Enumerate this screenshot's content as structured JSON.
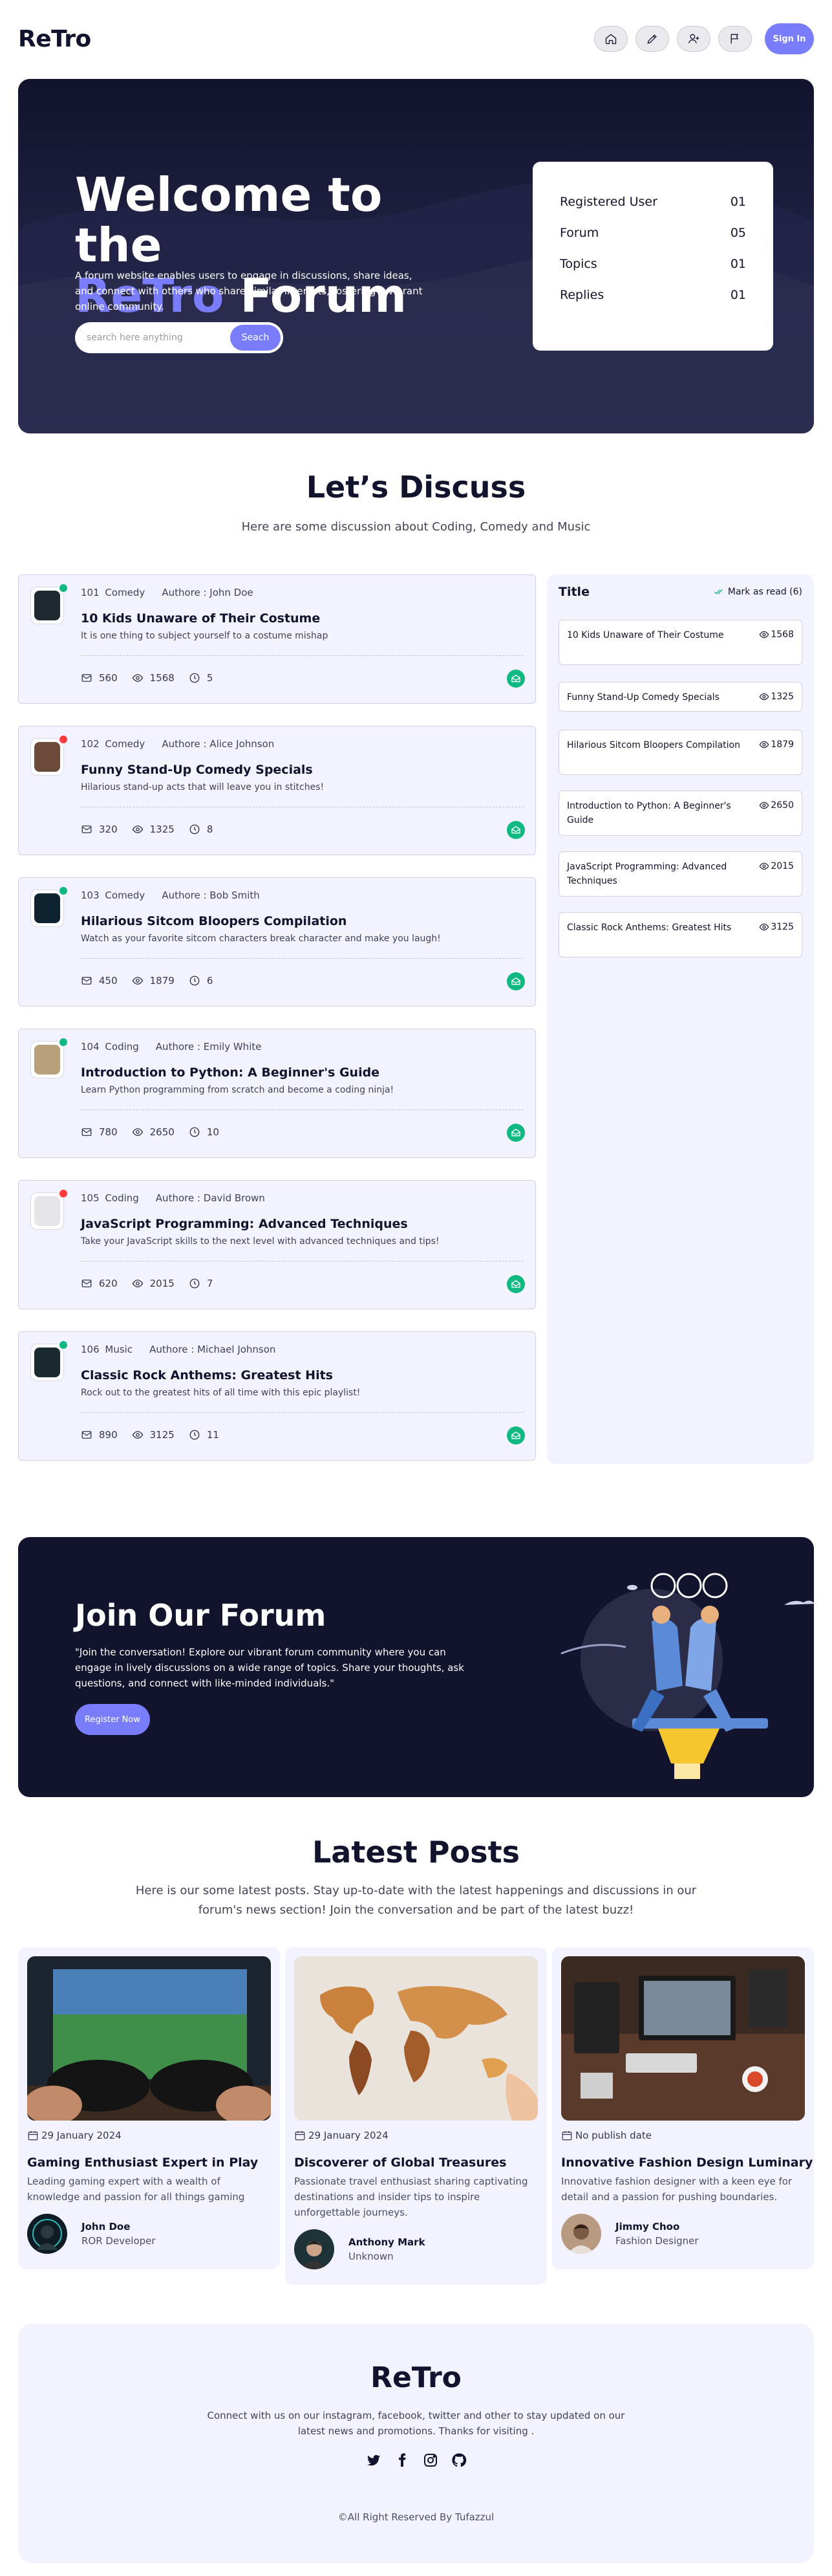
{
  "nav": {
    "logo": "ReTro",
    "icons": [
      "home-icon",
      "pencil-icon",
      "add-user-icon",
      "flag-icon"
    ],
    "signin": "Sign In"
  },
  "hero": {
    "title_line1": "Welcome to the",
    "title_accent": "ReTro",
    "title_rest": " Forum",
    "description": "A forum website enables users to engage in discussions, share ideas, and connect with others who share similar interests, fostering a vibrant online community.",
    "search_placeholder": "search here anything",
    "search_button": "Seach",
    "stats": [
      {
        "label": "Registered User",
        "value": "01"
      },
      {
        "label": "Forum",
        "value": "05"
      },
      {
        "label": "Topics",
        "value": "01"
      },
      {
        "label": "Replies",
        "value": "01"
      }
    ]
  },
  "discuss": {
    "title": "Let’s Discuss",
    "subtitle": "Here are some discussion about Coding, Comedy and Music",
    "posts": [
      {
        "id": "101",
        "category": "Comedy",
        "author": "Authore : John Doe",
        "title": "10 Kids Unaware of Their Costume",
        "desc": "It is one thing to subject yourself to a costume mishap",
        "comments": "560",
        "views": "1568",
        "time": "5",
        "status_color": "#10b981"
      },
      {
        "id": "102",
        "category": "Comedy",
        "author": "Authore : Alice Johnson",
        "title": "Funny Stand-Up Comedy Specials",
        "desc": "Hilarious stand-up acts that will leave you in stitches!",
        "comments": "320",
        "views": "1325",
        "time": "8",
        "status_color": "#ff3b3b"
      },
      {
        "id": "103",
        "category": "Comedy",
        "author": "Authore : Bob Smith",
        "title": "Hilarious Sitcom Bloopers Compilation",
        "desc": "Watch as your favorite sitcom characters break character and make you laugh!",
        "comments": "450",
        "views": "1879",
        "time": "6",
        "status_color": "#10b981"
      },
      {
        "id": "104",
        "category": "Coding",
        "author": "Authore : Emily White",
        "title": "Introduction to Python: A Beginner's Guide",
        "desc": "Learn Python programming from scratch and become a coding ninja!",
        "comments": "780",
        "views": "2650",
        "time": "10",
        "status_color": "#10b981"
      },
      {
        "id": "105",
        "category": "Coding",
        "author": "Authore : David Brown",
        "title": "JavaScript Programming: Advanced Techniques",
        "desc": "Take your JavaScript skills to the next level with advanced techniques and tips!",
        "comments": "620",
        "views": "2015",
        "time": "7",
        "status_color": "#ff3b3b"
      },
      {
        "id": "106",
        "category": "Music",
        "author": "Authore : Michael Johnson",
        "title": "Classic Rock Anthems: Greatest Hits",
        "desc": "Rock out to the greatest hits of all time with this epic playlist!",
        "comments": "890",
        "views": "3125",
        "time": "11",
        "status_color": "#10b981"
      }
    ],
    "sidebar": {
      "title": "Title",
      "mark_read": "Mark as read (6)",
      "items": [
        {
          "title": "10 Kids Unaware of Their Costume",
          "views": "1568"
        },
        {
          "title": "Funny Stand-Up Comedy Specials",
          "views": "1325"
        },
        {
          "title": "Hilarious Sitcom Bloopers Compilation",
          "views": "1879"
        },
        {
          "title": "Introduction to Python: A Beginner's Guide",
          "views": "2650"
        },
        {
          "title": "JavaScript Programming: Advanced Techniques",
          "views": "2015"
        },
        {
          "title": "Classic Rock Anthems: Greatest Hits",
          "views": "3125"
        }
      ]
    }
  },
  "join": {
    "title": "Join Our Forum",
    "text": "\"Join the conversation! Explore our vibrant forum community where you can engage in lively discussions on a wide range of topics. Share your thoughts, ask questions, and connect with like-minded individuals.\"",
    "button": "Register Now"
  },
  "latest": {
    "title": "Latest Posts",
    "subtitle": "Here is our some latest posts. Stay up-to-date with the latest happenings and discussions in our forum's news section! Join the conversation and be part of the latest buzz!",
    "cards": [
      {
        "date": "29 January 2024",
        "title": "Gaming Enthusiast Expert in Play",
        "desc": "Leading gaming expert with a wealth of knowledge and passion for all things gaming",
        "name": "John Doe",
        "role": "ROR Developer"
      },
      {
        "date": "29 January 2024",
        "title": "Discoverer of Global Treasures",
        "desc": "Passionate travel enthusiast sharing captivating destinations and insider tips to inspire unforgettable journeys.",
        "name": "Anthony Mark",
        "role": "Unknown"
      },
      {
        "date": "No publish date",
        "title": "Innovative Fashion Design Luminary",
        "desc": "Innovative fashion designer with a keen eye for detail and a passion for pushing boundaries.",
        "name": "Jimmy Choo",
        "role": "Fashion Designer"
      }
    ]
  },
  "footer": {
    "logo": "ReTro",
    "desc": "Connect with us on our instagram, facebook, twitter and other to stay updated on our latest news and promotions. Thanks for visiting .",
    "socials": [
      "twitter-icon",
      "facebook-icon",
      "instagram-icon",
      "github-icon"
    ],
    "copyright": "©All Right Reserved By Tufazzul"
  }
}
